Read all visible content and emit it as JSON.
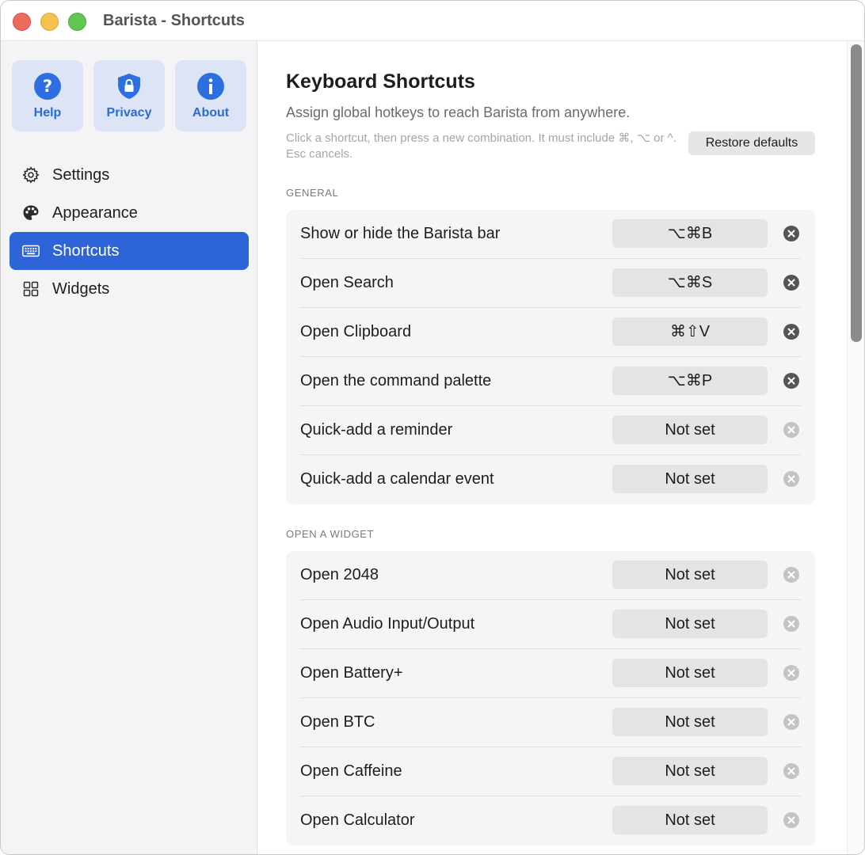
{
  "window": {
    "title": "Barista - Shortcuts"
  },
  "sidebar": {
    "tiles": [
      {
        "label": "Help",
        "icon": "question-icon"
      },
      {
        "label": "Privacy",
        "icon": "shield-lock-icon"
      },
      {
        "label": "About",
        "icon": "info-icon"
      }
    ],
    "items": [
      {
        "label": "Settings",
        "icon": "gear-icon"
      },
      {
        "label": "Appearance",
        "icon": "palette-icon"
      },
      {
        "label": "Shortcuts",
        "icon": "keyboard-icon",
        "active": true
      },
      {
        "label": "Widgets",
        "icon": "grid-icon"
      }
    ]
  },
  "main": {
    "title": "Keyboard Shortcuts",
    "subtitle": "Assign global hotkeys to reach Barista from anywhere.",
    "hint": "Click a shortcut, then press a new combination. It must include ⌘, ⌥ or ^. Esc cancels.",
    "restore_label": "Restore defaults",
    "sections": [
      {
        "label": "GENERAL",
        "rows": [
          {
            "label": "Show or hide the Barista bar",
            "shortcut": "⌥⌘B",
            "set": true
          },
          {
            "label": "Open Search",
            "shortcut": "⌥⌘S",
            "set": true
          },
          {
            "label": "Open Clipboard",
            "shortcut": "⌘⇧V",
            "set": true
          },
          {
            "label": "Open the command palette",
            "shortcut": "⌥⌘P",
            "set": true
          },
          {
            "label": "Quick-add a reminder",
            "shortcut": "Not set",
            "set": false
          },
          {
            "label": "Quick-add a calendar event",
            "shortcut": "Not set",
            "set": false
          }
        ]
      },
      {
        "label": "OPEN A WIDGET",
        "rows": [
          {
            "label": "Open 2048",
            "shortcut": "Not set",
            "set": false
          },
          {
            "label": "Open Audio Input/Output",
            "shortcut": "Not set",
            "set": false
          },
          {
            "label": "Open Battery+",
            "shortcut": "Not set",
            "set": false
          },
          {
            "label": "Open BTC",
            "shortcut": "Not set",
            "set": false
          },
          {
            "label": "Open Caffeine",
            "shortcut": "Not set",
            "set": false
          },
          {
            "label": "Open Calculator",
            "shortcut": "Not set",
            "set": false
          }
        ]
      }
    ]
  },
  "colors": {
    "accent": "#2d64d8",
    "tile_bg": "#dde4f6",
    "tile_text": "#2a6bd6",
    "clear_active": "#555555",
    "clear_inactive": "#c4c4c4"
  }
}
